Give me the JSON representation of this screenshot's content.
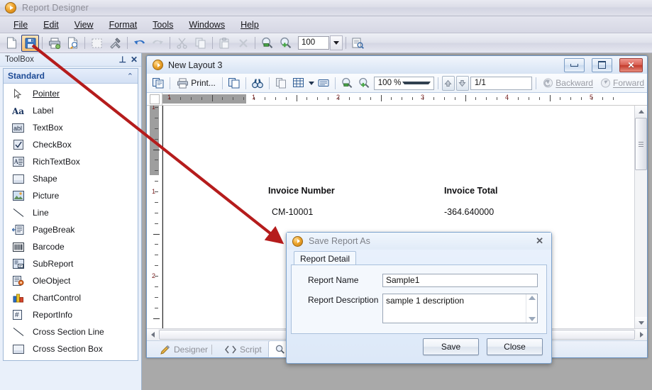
{
  "app": {
    "title": "Report Designer",
    "logo_icon": "play-circle-icon"
  },
  "menubar": {
    "items": [
      {
        "label": "File",
        "accel": "F"
      },
      {
        "label": "Edit",
        "accel": "E"
      },
      {
        "label": "View",
        "accel": "V"
      },
      {
        "label": "Format",
        "accel": "o"
      },
      {
        "label": "Tools",
        "accel": "T"
      },
      {
        "label": "Windows",
        "accel": "W"
      },
      {
        "label": "Help",
        "accel": "H"
      }
    ]
  },
  "toolbar": {
    "zoom_value": "100",
    "buttons": [
      {
        "name": "new-document-button",
        "icon": "new-page-icon",
        "selected": false
      },
      {
        "name": "save-button",
        "icon": "floppy-disk-icon",
        "selected": true
      },
      {
        "name": "print-button",
        "icon": "printer-icon",
        "selected": false
      },
      {
        "name": "print-preview-button",
        "icon": "print-preview-icon",
        "selected": false
      },
      {
        "name": "select-all-button",
        "icon": "dashed-rectangle-icon",
        "selected": false
      },
      {
        "name": "tools-button",
        "icon": "hammer-wrench-icon",
        "selected": false
      },
      {
        "name": "undo-button",
        "icon": "undo-arrow-icon",
        "selected": false
      },
      {
        "name": "redo-button",
        "icon": "redo-arrow-icon",
        "selected": false
      },
      {
        "name": "cut-button",
        "icon": "scissors-icon",
        "selected": false
      },
      {
        "name": "copy-button",
        "icon": "copy-icon",
        "selected": false
      },
      {
        "name": "paste-button",
        "icon": "clipboard-paste-icon",
        "selected": false
      },
      {
        "name": "delete-button",
        "icon": "x-delete-icon",
        "selected": false
      },
      {
        "name": "zoom-out-button",
        "icon": "magnifier-minus-icon",
        "selected": false
      },
      {
        "name": "zoom-in-button",
        "icon": "magnifier-plus-icon",
        "selected": false
      }
    ],
    "after_zoom_button": {
      "name": "report-properties-button",
      "icon": "report-magnifier-icon"
    }
  },
  "toolbox": {
    "title": "ToolBox",
    "pin_icon": "pin-icon",
    "close_icon": "close-icon",
    "group": {
      "label": "Standard",
      "collapse_icon": "chevron-up-icon"
    },
    "items": [
      {
        "label": "Pointer",
        "icon": "cursor-arrow-icon"
      },
      {
        "label": "Label",
        "icon": "aa-label-icon"
      },
      {
        "label": "TextBox",
        "icon": "abl-textbox-icon"
      },
      {
        "label": "CheckBox",
        "icon": "checkbox-icon"
      },
      {
        "label": "RichTextBox",
        "icon": "richtextbox-icon"
      },
      {
        "label": "Shape",
        "icon": "rectangle-shape-icon"
      },
      {
        "label": "Picture",
        "icon": "picture-icon"
      },
      {
        "label": "Line",
        "icon": "diagonal-line-icon"
      },
      {
        "label": "PageBreak",
        "icon": "pagebreak-icon"
      },
      {
        "label": "Barcode",
        "icon": "barcode-icon"
      },
      {
        "label": "SubReport",
        "icon": "subreport-icon"
      },
      {
        "label": "OleObject",
        "icon": "ole-object-icon"
      },
      {
        "label": "ChartControl",
        "icon": "bar-chart-icon"
      },
      {
        "label": "ReportInfo",
        "icon": "report-info-icon"
      },
      {
        "label": "Cross Section Line",
        "icon": "diagonal-line-icon"
      },
      {
        "label": "Cross Section Box",
        "icon": "rectangle-shape-icon"
      }
    ]
  },
  "child_window": {
    "title": "New Layout 3",
    "logo_icon": "play-circle-icon",
    "minimize_label": "Minimize",
    "maximize_label": "Maximize",
    "close_label": "Close",
    "toolbar": {
      "copy_layout_icon": "copy-pages-icon",
      "print_label": "Print...",
      "print_icon": "printer-icon",
      "copy_icon": "copy-icon",
      "find_icon": "binoculars-icon",
      "single_page_icon": "single-page-icon",
      "multi_page_icon": "multi-page-icon",
      "multi_page_caret": "chevron-down-icon",
      "page_setup_icon": "page-setup-icon",
      "zoom_out_icon": "magnifier-minus-icon",
      "zoom_in_icon": "magnifier-plus-icon",
      "zoom_value": "100 %",
      "zoom_caret": "chevron-down-icon",
      "prev_page_icon": "arrow-up-icon",
      "next_page_icon": "arrow-down-icon",
      "page_indicator": "1/1",
      "backward_label": "Backward",
      "backward_icon": "backward-history-icon",
      "forward_label": "Forward",
      "forward_icon": "forward-history-icon"
    },
    "ruler": {
      "h_numbers": [
        "1",
        "1",
        "2",
        "3",
        "4",
        "5"
      ],
      "v_numbers": [
        "1",
        "1",
        "2"
      ]
    },
    "report": {
      "header_invoice_number": "Invoice Number",
      "header_invoice_total": "Invoice Total",
      "value_invoice_number": "CM-10001",
      "value_invoice_total": "-364.640000"
    },
    "tabs": [
      {
        "label": "Designer",
        "icon": "pencil-icon",
        "active": false
      },
      {
        "label": "Script",
        "icon": "code-brackets-icon",
        "active": false
      },
      {
        "label": "Preview",
        "icon": "magnifier-icon",
        "active": true
      }
    ]
  },
  "dialog": {
    "title": "Save Report As",
    "logo_icon": "play-circle-icon",
    "close_icon": "close-icon",
    "tab_label": "Report Detail",
    "fields": [
      {
        "label": "Report Name",
        "value": "Sample1"
      },
      {
        "label": "Report Description",
        "value": "sample 1 description"
      }
    ],
    "scroll_up_icon": "triangle-up-icon",
    "scroll_down_icon": "triangle-down-icon",
    "save_label": "Save",
    "close_label": "Close"
  },
  "annotation": {
    "arrow_color": "#b51c1c",
    "arrow_from": "save-button",
    "arrow_to": "save-report-as-dialog"
  }
}
